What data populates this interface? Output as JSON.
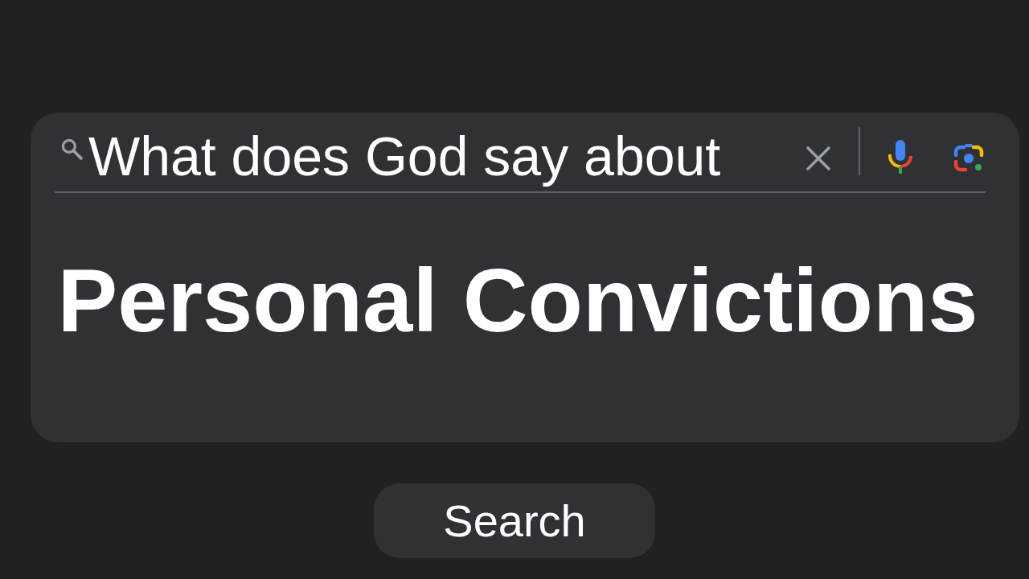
{
  "search": {
    "value": "What does God say about"
  },
  "heading": "Personal Convictions",
  "search_button": {
    "label": "Search"
  }
}
